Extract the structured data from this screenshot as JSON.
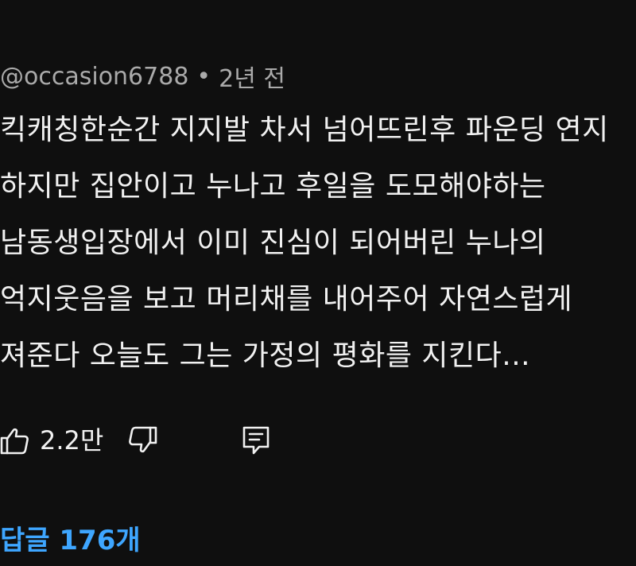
{
  "comment": {
    "author": "@occasion6788",
    "separator": "•",
    "timestamp": "2년 전",
    "lines": [
      "킥캐칭한순간 지지발 차서 넘어뜨린후 파운딩 연지",
      "하지만 집안이고 누나고 후일을 도모해야하는",
      "남동생입장에서 이미 진심이 되어버린 누나의",
      "억지웃음을 보고 머리채를 내어주어 자연스럽게",
      "져준다 오늘도 그는 가정의 평화를 지킨다..."
    ],
    "like_count": "2.2만",
    "replies_label": "답글 176개"
  },
  "icons": {
    "like": "thumbs-up-icon",
    "dislike": "thumbs-down-icon",
    "reply": "reply-comment-icon"
  },
  "colors": {
    "background": "#0f0f0f",
    "text": "#f1f1f1",
    "meta": "#aaaaaa",
    "link": "#3ea6ff"
  }
}
